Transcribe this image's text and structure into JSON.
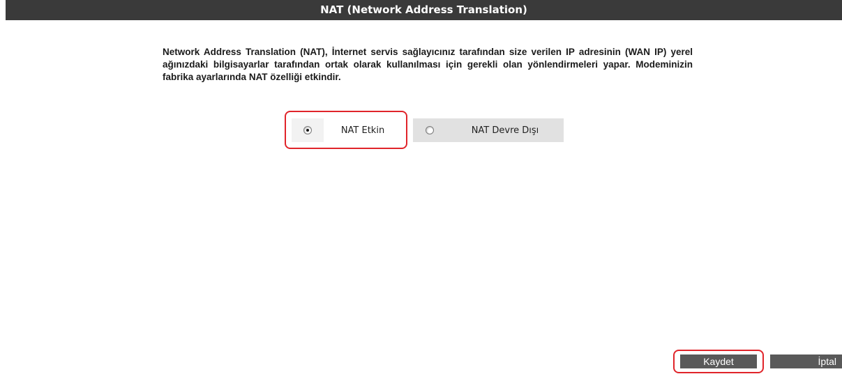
{
  "header": {
    "title": "NAT (Network Address Translation)"
  },
  "main": {
    "description": "Network Address Translation (NAT), İnternet servis sağlayıcınız tarafından size verilen IP adresinin (WAN IP) yerel ağınızdaki bilgisayarlar tarafından ortak olarak kullanılması için gerekli olan yönlendirmeleri yapar. Modeminizin fabrika ayarlarında NAT özelliği etkindir.",
    "nat_options": [
      {
        "label": "NAT Etkin",
        "selected": true
      },
      {
        "label": "NAT Devre Dışı",
        "selected": false
      }
    ]
  },
  "footer": {
    "save_label": "Kaydet",
    "cancel_label": "İptal"
  },
  "colors": {
    "title_bar": "#3a3a3a",
    "button": "#595959",
    "highlight": "#e0242a"
  }
}
